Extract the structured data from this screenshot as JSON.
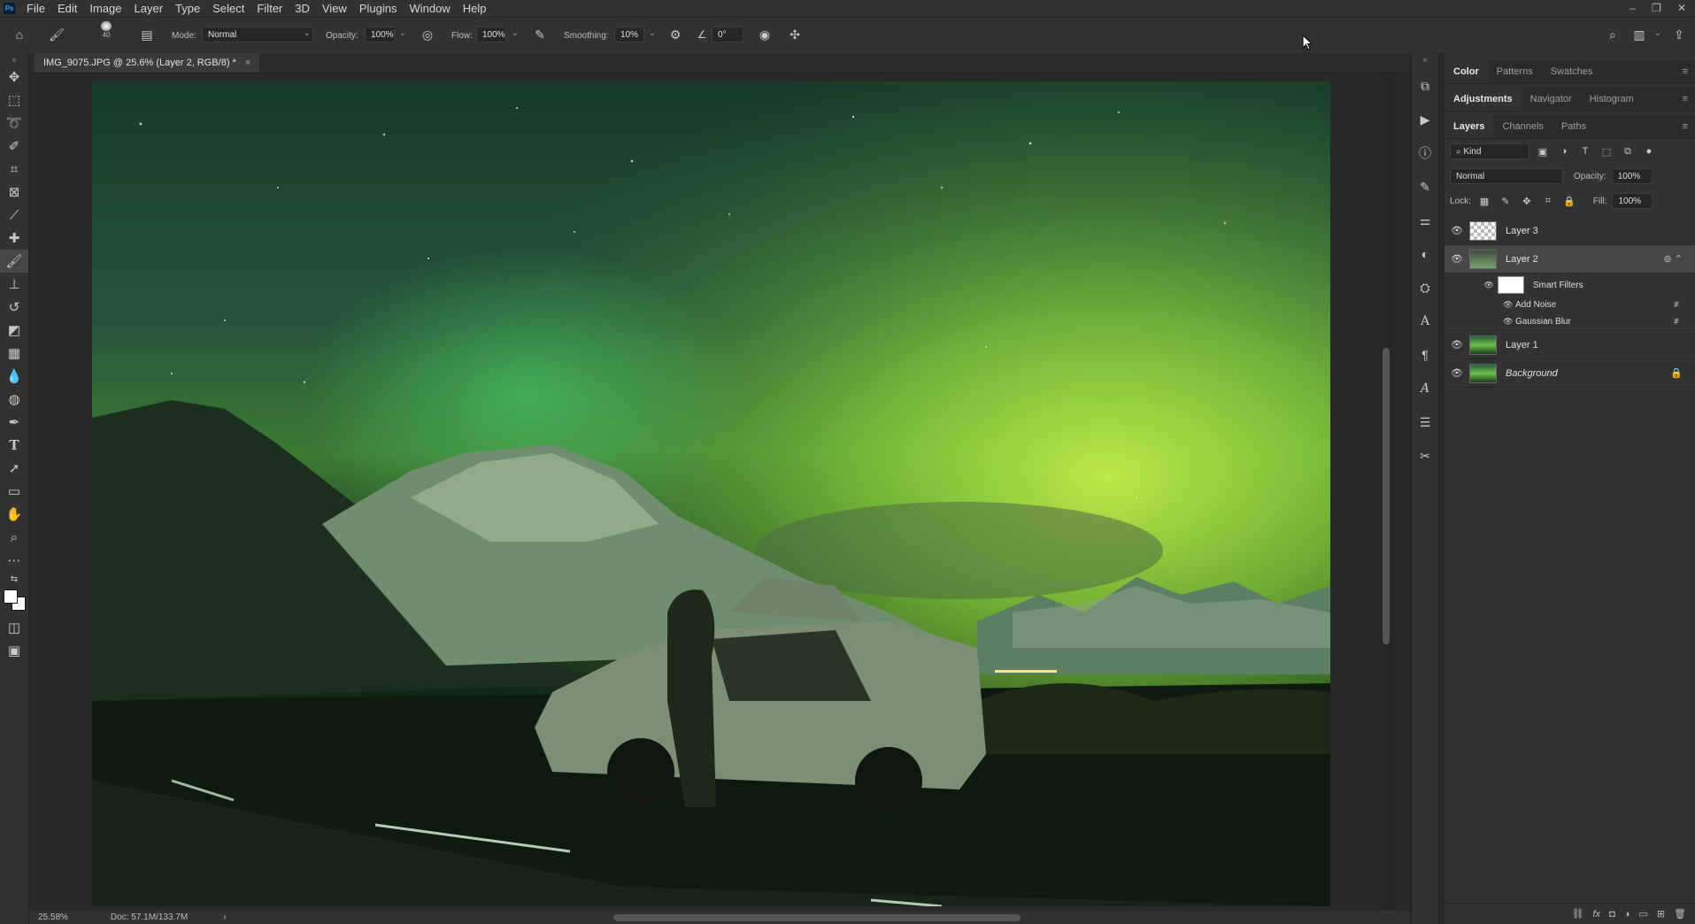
{
  "menubar": {
    "logo": "Ps",
    "items": [
      "File",
      "Edit",
      "Image",
      "Layer",
      "Type",
      "Select",
      "Filter",
      "3D",
      "View",
      "Plugins",
      "Window",
      "Help"
    ],
    "window_buttons": [
      "–",
      "❐",
      "✕"
    ]
  },
  "options": {
    "brush_size": "40",
    "mode_label": "Mode:",
    "mode_value": "Normal",
    "opacity_label": "Opacity:",
    "opacity_value": "100%",
    "flow_label": "Flow:",
    "flow_value": "100%",
    "smoothing_label": "Smoothing:",
    "smoothing_value": "10%",
    "angle_value": "0°"
  },
  "document": {
    "tab_title": "IMG_9075.JPG @ 25.6% (Layer 2, RGB/8) *",
    "close": "×"
  },
  "status": {
    "zoom": "25.58%",
    "doc_size": "Doc: 57.1M/133.7M",
    "arrow": "›"
  },
  "panels": {
    "color_group": {
      "tabs": [
        "Color",
        "Patterns",
        "Swatches"
      ],
      "active": "Color"
    },
    "adjust_group": {
      "tabs": [
        "Adjustments",
        "Navigator",
        "Histogram"
      ],
      "active": "Adjustments"
    },
    "layers_group": {
      "tabs": [
        "Layers",
        "Channels",
        "Paths"
      ],
      "active": "Layers"
    },
    "layers": {
      "filter_kind": "Kind",
      "blend_mode": "Normal",
      "opacity_label": "Opacity:",
      "opacity_value": "100%",
      "lock_label": "Lock:",
      "fill_label": "Fill:",
      "fill_value": "100%",
      "rows": [
        {
          "name": "Layer 3",
          "thumb": "transparent",
          "selected": false
        },
        {
          "name": "Layer 2",
          "thumb": "smart-object",
          "selected": true
        },
        {
          "name": "Smart Filters",
          "thumb": "white"
        },
        {
          "name": "Add Noise"
        },
        {
          "name": "Gaussian Blur"
        },
        {
          "name": "Layer 1",
          "thumb": "image",
          "selected": false
        },
        {
          "name": "Background",
          "thumb": "image",
          "selected": false,
          "locked": true
        }
      ]
    }
  }
}
